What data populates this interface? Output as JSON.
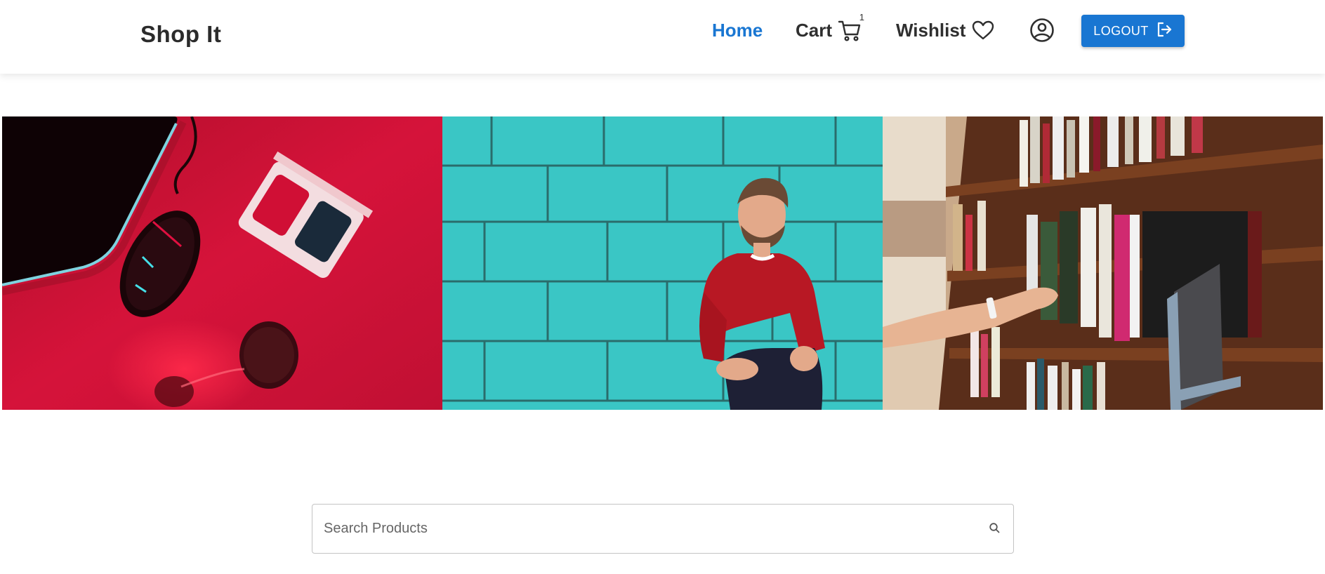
{
  "header": {
    "brand": "Shop It",
    "nav": {
      "home": "Home",
      "cart": "Cart",
      "cart_count": "1",
      "wishlist": "Wishlist"
    },
    "logout_label": "LOGOUT"
  },
  "banner": {
    "panels": [
      {
        "alt": "Gaming mouse, 3D glasses and hourglass on red surface"
      },
      {
        "alt": "Man in red sweater in front of turquoise brick wall"
      },
      {
        "alt": "Hand reaching for books on library shelf"
      }
    ]
  },
  "search": {
    "placeholder": "Search Products",
    "value": ""
  },
  "colors": {
    "accent": "#1976d2",
    "text": "#2f2f2f"
  }
}
